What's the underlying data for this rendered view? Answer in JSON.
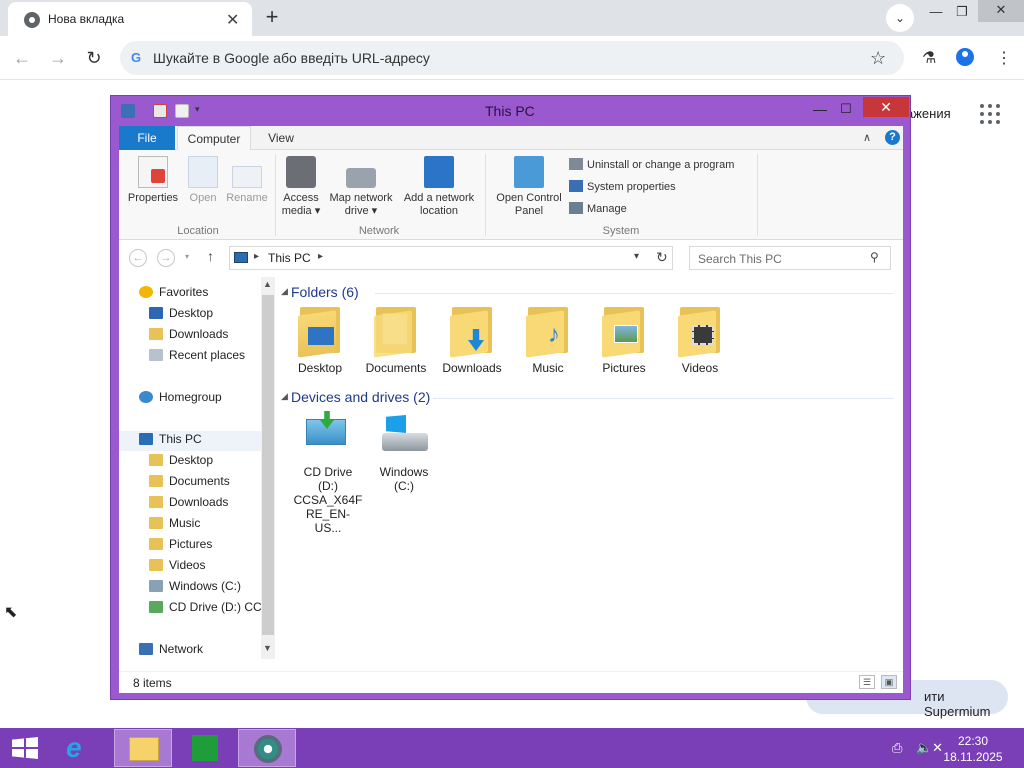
{
  "chrome": {
    "tab_title": "Нова вкладка",
    "omnibox_placeholder": "Шукайте в Google або введіть URL-адресу",
    "images_link": "ажения",
    "customize_label": "ити Supermium"
  },
  "explorer": {
    "title": "This PC",
    "ribbon_tabs": [
      "File",
      "Computer",
      "View"
    ],
    "ribbon": {
      "properties": "Properties",
      "open": "Open",
      "rename": "Rename",
      "access_media_1": "Access",
      "access_media_2": "media ▾",
      "map_network_1": "Map network",
      "map_network_2": "drive ▾",
      "add_network_1": "Add a network",
      "add_network_2": "location",
      "open_cp_1": "Open Control",
      "open_cp_2": "Panel",
      "uninstall": "Uninstall or change a program",
      "system_properties": "System properties",
      "manage": "Manage",
      "group_location": "Location",
      "group_network": "Network",
      "group_system": "System"
    },
    "address": {
      "path": "This PC",
      "search_placeholder": "Search This PC"
    },
    "nav": {
      "favorites": "Favorites",
      "fav_desktop": "Desktop",
      "fav_downloads": "Downloads",
      "fav_recent": "Recent places",
      "homegroup": "Homegroup",
      "thispc": "This PC",
      "pc_desktop": "Desktop",
      "pc_documents": "Documents",
      "pc_downloads": "Downloads",
      "pc_music": "Music",
      "pc_pictures": "Pictures",
      "pc_videos": "Videos",
      "pc_windows": "Windows (C:)",
      "pc_cd": "CD Drive (D:) CCS",
      "network": "Network"
    },
    "content": {
      "folders_header": "Folders (6)",
      "folders": [
        "Desktop",
        "Documents",
        "Downloads",
        "Music",
        "Pictures",
        "Videos"
      ],
      "devices_header": "Devices and drives (2)",
      "cd_drive_1": "CD Drive",
      "cd_drive_2": "(D:)",
      "cd_drive_3": "CCSA_X64F",
      "cd_drive_4": "RE_EN-US...",
      "windows_1": "Windows",
      "windows_2": "(C:)"
    },
    "status": "8 items"
  },
  "taskbar": {
    "time": "22:30",
    "date": "18.11.2025"
  },
  "colors": {
    "window_frame": "#9b59d0",
    "taskbar": "#7a3eb6",
    "accent_blue": "#1979ca",
    "close_red": "#c7373a"
  }
}
